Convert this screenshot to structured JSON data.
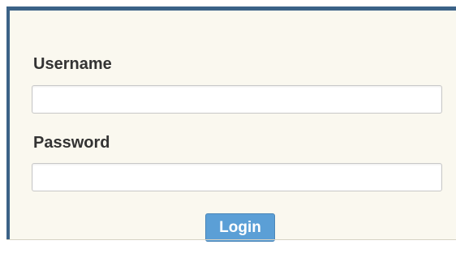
{
  "login_form": {
    "username_label": "Username",
    "username_value": "",
    "password_label": "Password",
    "password_value": "",
    "login_label": "Login"
  },
  "colors": {
    "panel_background": "#faf8ef",
    "panel_border": "#3b6287",
    "button_background": "#5b9fd6"
  }
}
